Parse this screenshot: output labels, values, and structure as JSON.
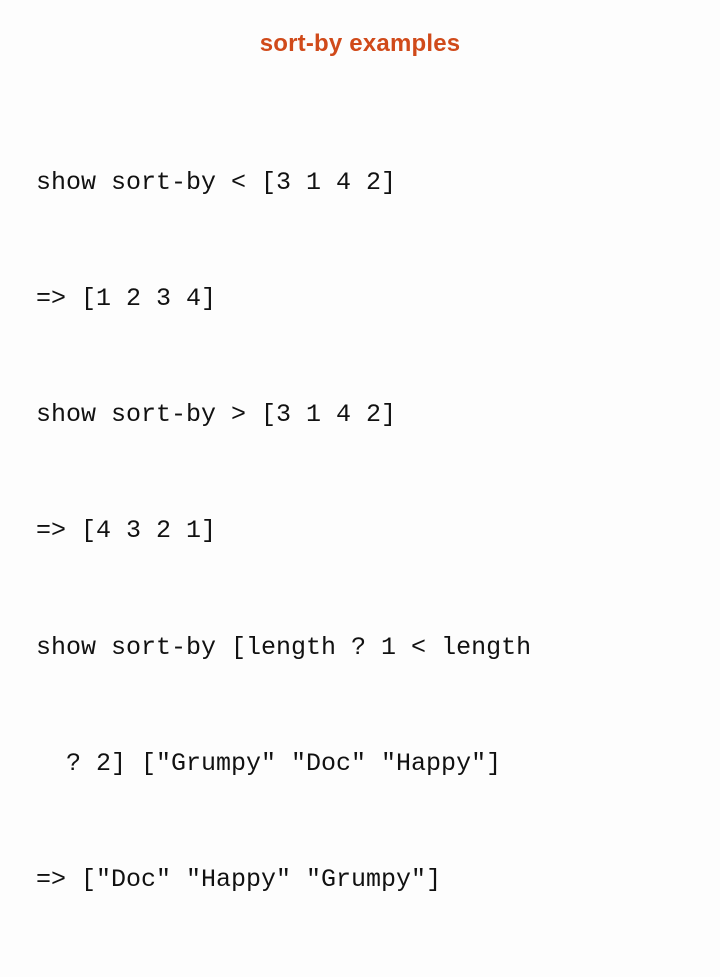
{
  "title": "sort-by examples",
  "lines": {
    "l1": "show sort-by < [3 1 4 2]",
    "l2": "=> [1 2 3 4]",
    "l3": "show sort-by > [3 1 4 2]",
    "l4": "=> [4 3 2 1]",
    "l5a": "show sort-by [length ? 1 < length",
    "l5b": "? 2] [\"Grumpy\" \"Doc\" \"Happy\"]",
    "l6": "=> [\"Doc\" \"Happy\" \"Grumpy\"]"
  }
}
